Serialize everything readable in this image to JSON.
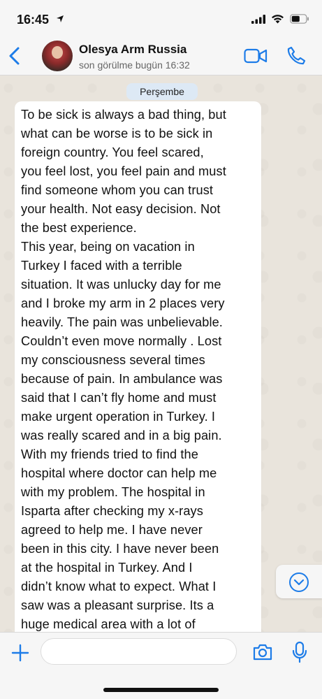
{
  "status_bar": {
    "time": "16:45"
  },
  "header": {
    "contact_name": "Olesya Arm Russia",
    "last_seen": "son görülme bugün 16:32"
  },
  "chat": {
    "date_label": "Perşembe",
    "message": "To be sick is always a bad thing, but\nwhat can be worse is to be sick in\nforeign country. You feel scared,\nyou feel lost, you feel pain and must\nfind someone whom you can trust\nyour health. Not easy decision. Not\nthe best experience.\nThis year, being on vacation in\nTurkey I faced with a terrible\nsituation. It was unlucky day for me\nand I broke my arm in 2 places very\nheavily. The pain was unbelievable.\nCouldn’t even move normally . Lost\nmy consciousness several times\nbecause of pain. In ambulance was\nsaid that I can’t fly home and must\nmake urgent operation in Turkey. I\nwas really scared and in a big pain.\nWith my friends tried to find the\nhospital where doctor can help me\nwith my problem. The hospital in\nIsparta after checking my x-rays\nagreed to help me. I have never\nbeen in this city. I have never been\nat the hospital in Turkey. And I\ndidn’t know what to expect. What I\nsaw was a pleasant surprise. Its a\nhuge medical area with a lot of"
  },
  "input_bar": {
    "placeholder": ""
  },
  "colors": {
    "accent": "#1d7ce8",
    "chat_background": "#e9e4dc",
    "bubble": "#ffffff",
    "date_chip": "#dde9f5"
  },
  "icons": {
    "location_arrow": "location-arrow-icon",
    "signal": "signal-icon",
    "wifi": "wifi-icon",
    "battery": "battery-icon",
    "back": "chevron-left-icon",
    "video": "video-camera-icon",
    "call": "phone-icon",
    "scroll_down": "chevron-down-circle-icon",
    "plus": "plus-icon",
    "camera": "camera-icon",
    "mic": "microphone-icon"
  }
}
